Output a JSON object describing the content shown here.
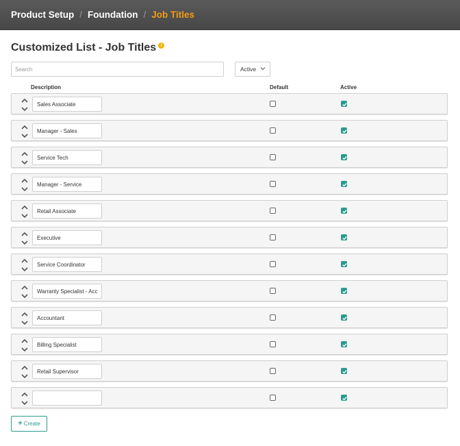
{
  "breadcrumb": {
    "items": [
      "Product Setup",
      "Foundation",
      "Job Titles"
    ],
    "separator": "/"
  },
  "page": {
    "title": "Customized List - Job Titles",
    "info_icon": "info-icon"
  },
  "search": {
    "placeholder": "Search",
    "value": ""
  },
  "status_filter": {
    "selected": "Active"
  },
  "columns": {
    "description": "Description",
    "default": "Default",
    "active": "Active"
  },
  "rows": [
    {
      "description": "Sales Associate",
      "default": false,
      "active": true
    },
    {
      "description": "Manager - Sales",
      "default": false,
      "active": true
    },
    {
      "description": "Service Tech",
      "default": false,
      "active": true
    },
    {
      "description": "Manager - Service",
      "default": false,
      "active": true
    },
    {
      "description": "Retail Associate",
      "default": false,
      "active": true
    },
    {
      "description": "Executive",
      "default": false,
      "active": true
    },
    {
      "description": "Service Coordinator",
      "default": false,
      "active": true
    },
    {
      "description": "Warranty Specialist - Acc",
      "default": false,
      "active": true
    },
    {
      "description": "Accountant",
      "default": false,
      "active": true
    },
    {
      "description": "Billing Specialist",
      "default": false,
      "active": true
    },
    {
      "description": "Retail Supervisor",
      "default": false,
      "active": true
    },
    {
      "description": "",
      "default": false,
      "active": true
    }
  ],
  "create_button": {
    "label": "Create",
    "icon": "plus-icon"
  },
  "colors": {
    "accent": "#2b9b8f",
    "breadcrumb_current": "#f39c12",
    "topbar": "#4f4f4f"
  }
}
